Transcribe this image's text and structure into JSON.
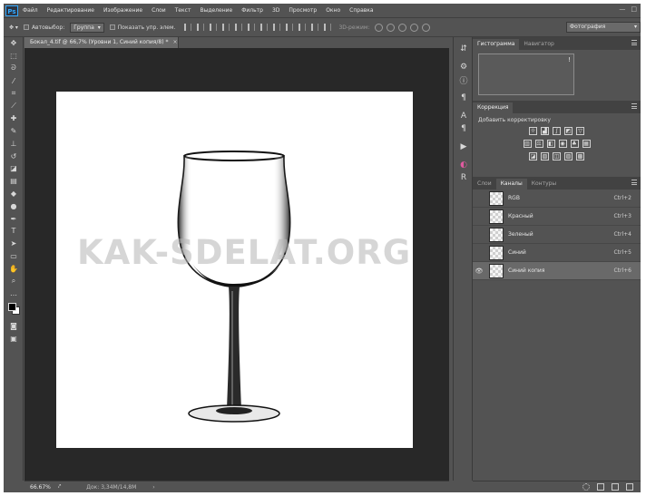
{
  "app": {
    "logo": "Ps",
    "menu": [
      "Файл",
      "Редактирование",
      "Изображение",
      "Слои",
      "Текст",
      "Выделение",
      "Фильтр",
      "3D",
      "Просмотр",
      "Окно",
      "Справка"
    ],
    "window_controls": [
      "—",
      "□"
    ]
  },
  "options": {
    "autoselect_label": "Автовыбор:",
    "autoselect_value": "Группа",
    "show_transform_label": "Показать упр. элем.",
    "mode3d_label": "3D-режим:",
    "workspace": "Фотография"
  },
  "document": {
    "tab_title": "Бокал_4.tif @ 66,7% (Уровни 1, Синий копия/8) *",
    "close": "×",
    "watermark": "KAK-SDELAT.ORG"
  },
  "status": {
    "zoom": "66.67%",
    "doc_size": "Док: 3,34M/14,8M",
    "arrow": "›"
  },
  "panels": {
    "top_tabs": [
      "Гистограмма",
      "Навигатор"
    ],
    "corrections_tab": "Коррекция",
    "corrections_title": "Добавить корректировку",
    "layers_tabs": [
      "Слои",
      "Каналы",
      "Контуры"
    ],
    "warning": "!"
  },
  "channels": [
    {
      "name": "RGB",
      "shortcut": "Ctrl+2",
      "visible": false,
      "selected": false
    },
    {
      "name": "Красный",
      "shortcut": "Ctrl+3",
      "visible": false,
      "selected": false
    },
    {
      "name": "Зеленый",
      "shortcut": "Ctrl+4",
      "visible": false,
      "selected": false
    },
    {
      "name": "Синий",
      "shortcut": "Ctrl+5",
      "visible": false,
      "selected": false
    },
    {
      "name": "Синий копия",
      "shortcut": "Ctrl+6",
      "visible": true,
      "selected": true
    }
  ],
  "colors": {
    "ui": "#535353",
    "workspace": "#282828",
    "accent": "#31a8ff"
  },
  "tools": [
    "move-icon",
    "marquee-icon",
    "lasso-icon",
    "magic-wand-icon",
    "crop-icon",
    "eyedropper-icon",
    "healing-brush-icon",
    "brush-icon",
    "stamp-icon",
    "history-brush-icon",
    "eraser-icon",
    "gradient-icon",
    "blur-icon",
    "dodge-icon",
    "pen-icon",
    "type-icon",
    "path-select-icon",
    "shape-icon",
    "hand-icon",
    "zoom-icon",
    "more-icon"
  ]
}
